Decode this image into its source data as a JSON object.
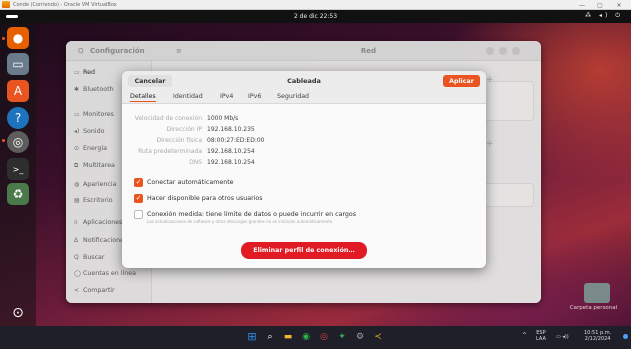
{
  "colors": {
    "accent": "#e95420",
    "danger": "#e01b24",
    "topbar": "#111111"
  },
  "vm": {
    "title": "Conde (Corriendo) - Oracle VM VirtualBox",
    "minimize": "—",
    "maximize": "▢",
    "close": "✕"
  },
  "topbar": {
    "clock": "2 de dic 22:53",
    "tray_icons": [
      "network-icon",
      "volume-icon",
      "power-icon"
    ],
    "tray_glyphs": "⁂ ◂) ⏻"
  },
  "dock": {
    "items": [
      {
        "name": "firefox",
        "icon": "firefox-icon",
        "glyph": "●",
        "color": "#e66000"
      },
      {
        "name": "files",
        "icon": "files-icon",
        "glyph": "▭",
        "color": "#6a7b8c"
      },
      {
        "name": "app-center",
        "icon": "app-center-icon",
        "glyph": "A",
        "color": "#e95420"
      },
      {
        "name": "help",
        "icon": "help-icon",
        "glyph": "?",
        "color": "#1e73be"
      },
      {
        "name": "settings",
        "icon": "settings-icon",
        "glyph": "◎",
        "color": "#5d5d5d"
      },
      {
        "name": "terminal",
        "icon": "terminal-icon",
        "glyph": ">_",
        "color": "#2e2e2e"
      },
      {
        "name": "trash",
        "icon": "trash-icon",
        "glyph": "♻",
        "color": "#4a7a4a"
      }
    ],
    "show_apps_glyph": "⊙"
  },
  "desktop": {
    "folder_label": "Carpeta personal"
  },
  "settings": {
    "search_glyph": "Q",
    "title": "Configuración",
    "menu_glyph": "≡",
    "panel_title": "Red",
    "sidebar": [
      {
        "label": "Red",
        "icon": "network-icon",
        "glyph": "▭"
      },
      {
        "label": "Bluetooth",
        "icon": "bluetooth-icon",
        "glyph": "✱"
      },
      {
        "label": "Monitores",
        "icon": "monitor-icon",
        "glyph": "▭"
      },
      {
        "label": "Sonido",
        "icon": "sound-icon",
        "glyph": "◂)"
      },
      {
        "label": "Energía",
        "icon": "power-icon",
        "glyph": "⊙"
      },
      {
        "label": "Multitarea",
        "icon": "multitasking-icon",
        "glyph": "⧉"
      },
      {
        "label": "Apariencia",
        "icon": "appearance-icon",
        "glyph": "◍"
      },
      {
        "label": "Escritorio",
        "icon": "desktop-icon",
        "glyph": "▤"
      },
      {
        "label": "Aplicaciones",
        "icon": "apps-icon",
        "glyph": "⁞⁞"
      },
      {
        "label": "Notificaciones",
        "icon": "notifications-icon",
        "glyph": "Δ"
      },
      {
        "label": "Buscar",
        "icon": "search-icon",
        "glyph": "Q"
      },
      {
        "label": "Cuentas en línea",
        "icon": "online-accounts-icon",
        "glyph": "◯"
      },
      {
        "label": "Compartir",
        "icon": "share-icon",
        "glyph": "<"
      }
    ]
  },
  "dialog": {
    "cancel_label": "Cancelar",
    "title": "Cableada",
    "apply_label": "Aplicar",
    "tabs": [
      "Detalles",
      "Identidad",
      "IPv4",
      "IPv6",
      "Seguridad"
    ],
    "details": [
      {
        "label": "Velocidad de conexión",
        "value": "1000 Mb/s"
      },
      {
        "label": "Dirección IP",
        "value": "192.168.10.235"
      },
      {
        "label": "Dirección física",
        "value": "08:00:27:ED:ED:00"
      },
      {
        "label": "Ruta predeterminada",
        "value": "192.168.10.254"
      },
      {
        "label": "DNS",
        "value": "192.168.10.254"
      }
    ],
    "auto_connect": {
      "label": "Conectar automáticamente",
      "checked": true
    },
    "available_others": {
      "label": "Hacer disponible para otros usuarios",
      "checked": true
    },
    "metered": {
      "label": "Conexión medida: tiene límite de datos o puede incurrir en cargos",
      "sublabel": "Las actualizaciones de software y otras descargas grandes no se iniciarán automáticamente.",
      "checked": false
    },
    "delete_label": "Eliminar perfil de conexión…"
  },
  "taskbar": {
    "icons": [
      {
        "name": "windows-start",
        "icon": "windows-icon",
        "glyph": "⊞",
        "color": "#2d8ee6"
      },
      {
        "name": "search",
        "icon": "search-icon",
        "glyph": "⌕",
        "color": "transparent"
      },
      {
        "name": "file-explorer",
        "icon": "folder-icon",
        "glyph": "▬",
        "color": "#f2b632"
      },
      {
        "name": "app-1",
        "icon": "green-app-icon",
        "glyph": "◉",
        "color": "#2bb24c"
      },
      {
        "name": "chrome",
        "icon": "chrome-icon",
        "glyph": "◎",
        "color": "#db4437"
      },
      {
        "name": "app-2",
        "icon": "multicolor-app-icon",
        "glyph": "✦",
        "color": "#34a853"
      },
      {
        "name": "app-3",
        "icon": "settings-app-icon",
        "glyph": "⚙",
        "color": "#555555"
      },
      {
        "name": "vs-code",
        "icon": "editor-icon",
        "glyph": "≺",
        "color": "#e0b020"
      }
    ],
    "tray": {
      "chevron": "^",
      "lang": "ESP",
      "layout": "LAA",
      "sys_icons": "▭ ◂))",
      "time": "10:51 p.m.",
      "date": "2/12/2024"
    }
  }
}
